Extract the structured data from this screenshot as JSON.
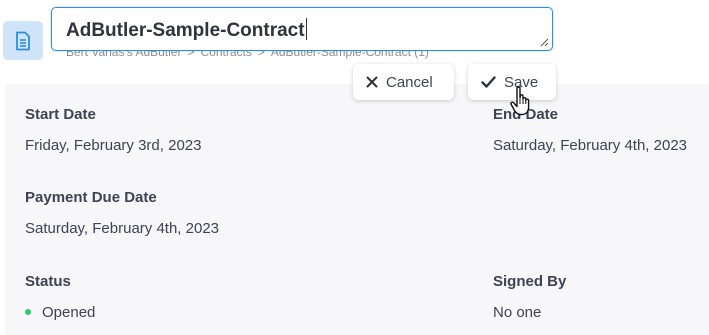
{
  "header": {
    "title_value": "AdButler-Sample-Contract",
    "breadcrumb": [
      "Bert Vanas's AdButler",
      "Contracts",
      "AdButler-Sample-Contract (1)"
    ],
    "breadcrumb_separator": ">",
    "icon": "document-icon",
    "accent_color": "#2f8ed8"
  },
  "actions": {
    "cancel_label": "Cancel",
    "cancel_icon": "close-icon",
    "save_label": "Save",
    "save_icon": "checkmark-icon"
  },
  "details": {
    "start_date": {
      "label": "Start Date",
      "value": "Friday, February 3rd, 2023"
    },
    "end_date": {
      "label": "End Date",
      "value": "Saturday, February 4th, 2023"
    },
    "payment_due_date": {
      "label": "Payment Due Date",
      "value": "Saturday, February 4th, 2023"
    },
    "status": {
      "label": "Status",
      "value": "Opened",
      "color": "#2ecc71"
    },
    "signed_by": {
      "label": "Signed By",
      "value": "No one"
    }
  }
}
